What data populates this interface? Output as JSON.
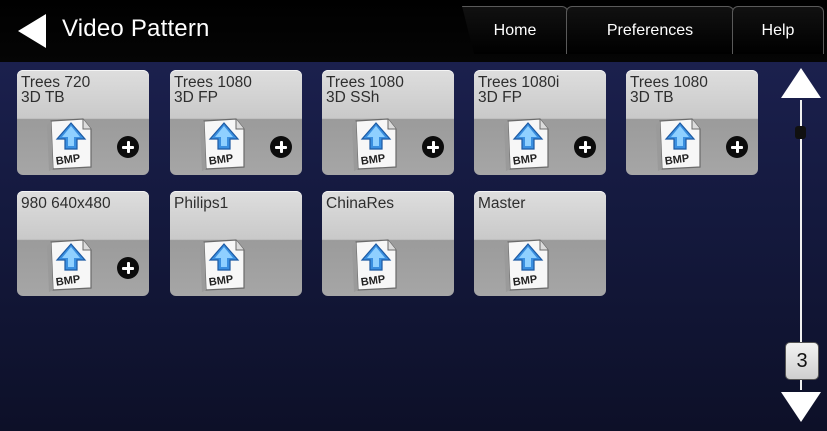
{
  "header": {
    "title": "Video Pattern",
    "tabs": [
      {
        "label": "Home"
      },
      {
        "label": "Preferences"
      },
      {
        "label": "Help"
      }
    ]
  },
  "patterns": [
    {
      "label": "Trees 720\n3D TB",
      "icon": "bmp-file-icon",
      "addable": true
    },
    {
      "label": "Trees 1080\n3D FP",
      "icon": "bmp-file-icon",
      "addable": true
    },
    {
      "label": "Trees 1080\n3D SSh",
      "icon": "bmp-file-icon",
      "addable": true
    },
    {
      "label": "Trees 1080i\n3D FP",
      "icon": "bmp-file-icon",
      "addable": true
    },
    {
      "label": "Trees 1080\n3D TB",
      "icon": "bmp-file-icon",
      "addable": true
    },
    {
      "label": "980 640x480",
      "icon": "bmp-file-icon",
      "addable": true
    },
    {
      "label": "Philips1",
      "icon": "bmp-file-icon",
      "addable": false
    },
    {
      "label": "ChinaRes",
      "icon": "bmp-file-icon",
      "addable": false
    },
    {
      "label": "Master",
      "icon": "bmp-file-icon",
      "addable": false
    }
  ],
  "pager": {
    "page": "3"
  },
  "colors": {
    "background": "#1b2050",
    "tile": "#c9c9c9",
    "header": "#000000"
  }
}
